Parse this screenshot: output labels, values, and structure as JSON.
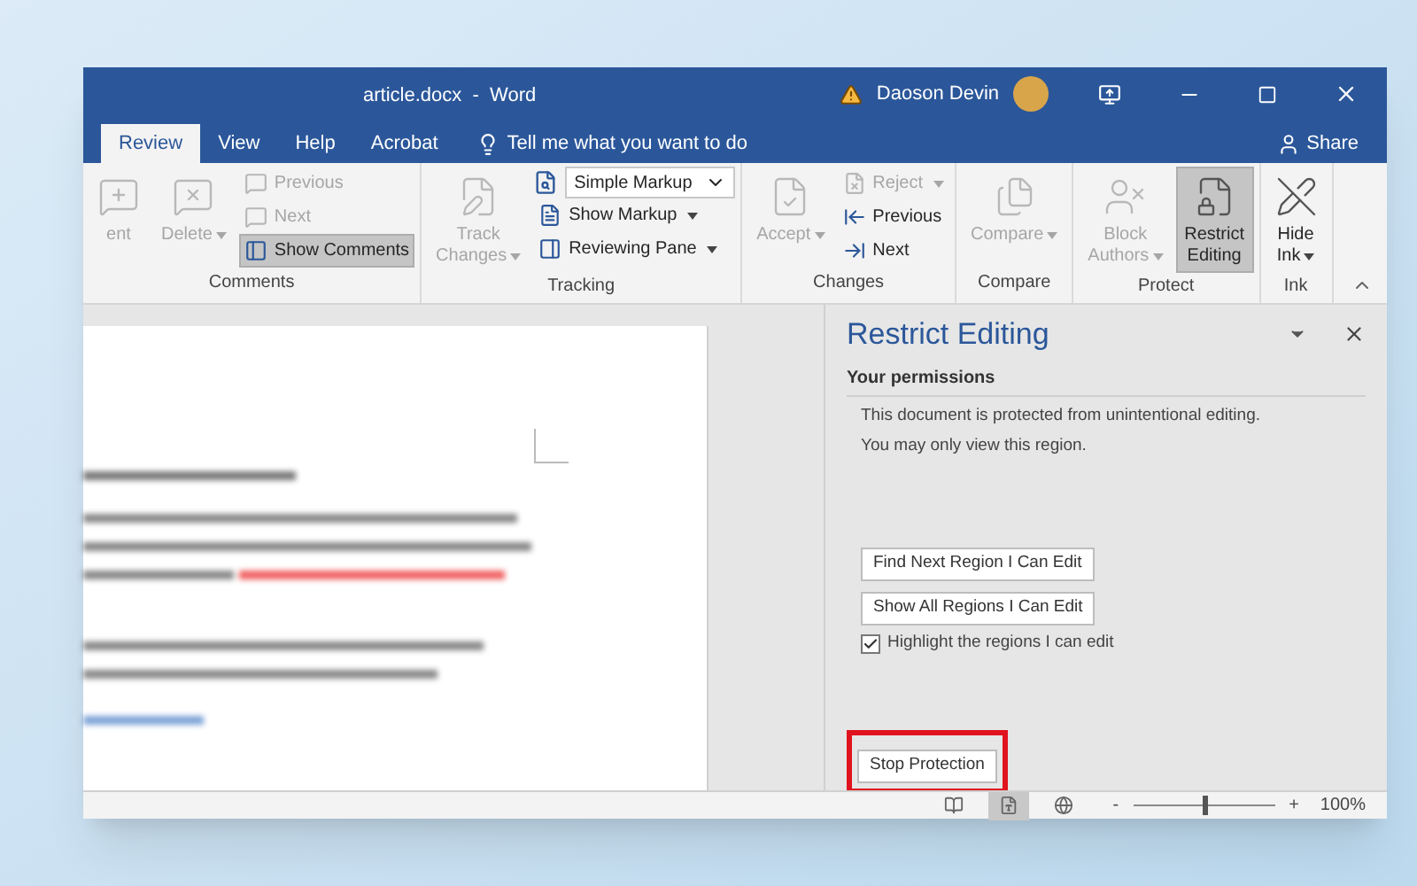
{
  "window": {
    "title": "article.docx  -  Word",
    "user": "Daoson Devin"
  },
  "tabs": [
    {
      "label": "Review",
      "selected": true
    },
    {
      "label": "View",
      "selected": false
    },
    {
      "label": "Help",
      "selected": false
    },
    {
      "label": "Acrobat",
      "selected": false
    }
  ],
  "tell_me": {
    "placeholder": "Tell me what you want to do"
  },
  "share": {
    "label": "Share"
  },
  "ribbon_groups": [
    {
      "title": "Comments",
      "columns": [
        [
          {
            "kind": "large",
            "lines": [
              "ent"
            ],
            "disabled": true,
            "selected": false,
            "caret": false
          }
        ],
        [
          {
            "kind": "large",
            "lines": [
              "Delete"
            ],
            "disabled": true,
            "selected": false,
            "caret": true
          }
        ],
        [
          {
            "kind": "small",
            "label": "Previous",
            "disabled": true,
            "selected": false,
            "caret": false
          },
          {
            "kind": "small",
            "label": "Next",
            "disabled": true,
            "selected": false,
            "caret": false
          },
          {
            "kind": "small",
            "label": "Show Comments",
            "disabled": false,
            "selected": true,
            "caret": false
          }
        ]
      ]
    },
    {
      "title": "Tracking",
      "columns": [
        [
          {
            "kind": "large",
            "lines": [
              "Track",
              "Changes"
            ],
            "disabled": true,
            "selected": false,
            "caret": true
          }
        ],
        [
          {
            "kind": "select",
            "label": "Simple Markup",
            "disabled": false,
            "caret": true
          },
          {
            "kind": "small",
            "label": "Show Markup",
            "disabled": false,
            "selected": false,
            "caret": true
          },
          {
            "kind": "small",
            "label": "Reviewing Pane",
            "disabled": false,
            "selected": false,
            "caret": true
          }
        ]
      ]
    },
    {
      "title": "Changes",
      "columns": [
        [
          {
            "kind": "large",
            "lines": [
              "Accept"
            ],
            "disabled": true,
            "selected": false,
            "caret": true
          }
        ],
        [
          {
            "kind": "small",
            "label": "Reject",
            "disabled": true,
            "selected": false,
            "caret": true
          },
          {
            "kind": "small",
            "label": "Previous",
            "disabled": false,
            "selected": false,
            "caret": false
          },
          {
            "kind": "small",
            "label": "Next",
            "disabled": false,
            "selected": false,
            "caret": false
          }
        ]
      ]
    },
    {
      "title": "Compare",
      "columns": [
        [
          {
            "kind": "large",
            "lines": [
              "Compare"
            ],
            "disabled": true,
            "selected": false,
            "caret": true
          }
        ]
      ]
    },
    {
      "title": "Protect",
      "columns": [
        [
          {
            "kind": "large",
            "lines": [
              "Block",
              "Authors"
            ],
            "disabled": true,
            "selected": false,
            "caret": true
          }
        ],
        [
          {
            "kind": "large",
            "lines": [
              "Restrict",
              "Editing"
            ],
            "disabled": false,
            "selected": true,
            "caret": false
          }
        ]
      ]
    },
    {
      "title": "Ink",
      "columns": [
        [
          {
            "kind": "large",
            "lines": [
              "Hide",
              "Ink"
            ],
            "disabled": false,
            "selected": false,
            "caret": true
          }
        ]
      ]
    }
  ],
  "pane": {
    "title": "Restrict Editing",
    "section": "Your permissions",
    "message_lines": [
      "This document is protected from unintentional editing.",
      "You may only view this region."
    ],
    "buttons": [
      {
        "label": "Find Next Region I Can Edit"
      },
      {
        "label": "Show All Regions I Can Edit"
      }
    ],
    "checkbox": {
      "label": "Highlight the regions I can edit",
      "checked": true
    },
    "stop_button": {
      "label": "Stop Protection",
      "highlighted": true
    }
  },
  "status_bar": {
    "views": [
      {
        "selected": false
      },
      {
        "selected": true
      },
      {
        "selected": false
      }
    ],
    "zoom_out": "-",
    "zoom_in": "+",
    "zoom": {
      "level": 0.5
    },
    "zoom_label": "100%"
  }
}
